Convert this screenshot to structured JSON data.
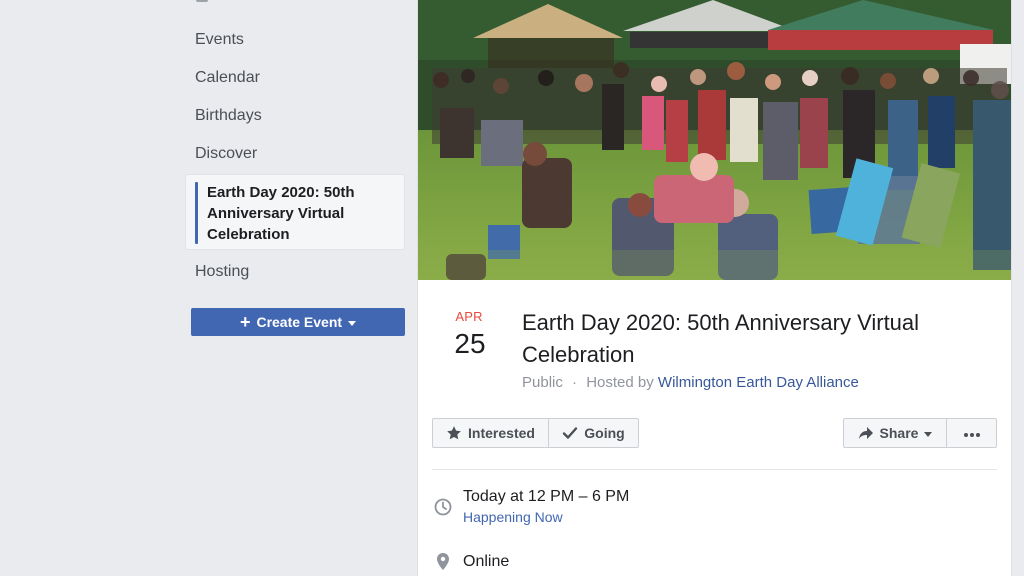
{
  "sidebar": {
    "items": [
      {
        "label": "Events"
      },
      {
        "label": "Calendar"
      },
      {
        "label": "Birthdays"
      },
      {
        "label": "Discover"
      },
      {
        "label": "Earth Day 2020: 50th Anniversary Virtual Celebration"
      },
      {
        "label": "Hosting"
      }
    ],
    "create_event_label": "Create Event"
  },
  "event": {
    "date": {
      "month": "APR",
      "day": "25"
    },
    "title": "Earth Day 2020: 50th Anniversary Virtual Celebration",
    "privacy": "Public",
    "separator": "·",
    "hosted_by_label": "Hosted by",
    "host": "Wilmington Earth Day Alliance",
    "actions": {
      "interested": "Interested",
      "going": "Going",
      "share": "Share"
    },
    "time": "Today at 12 PM – 6 PM",
    "status": "Happening Now",
    "location": "Online"
  },
  "colors": {
    "accent": "#4267b2",
    "month": "#e9483d",
    "link": "#385898",
    "page_background": "#e9ebee"
  },
  "icons": {
    "interested": "star-icon",
    "going": "check-icon",
    "share": "share-icon",
    "more": "more-icon",
    "time": "clock-icon",
    "location": "location-pin-icon"
  }
}
